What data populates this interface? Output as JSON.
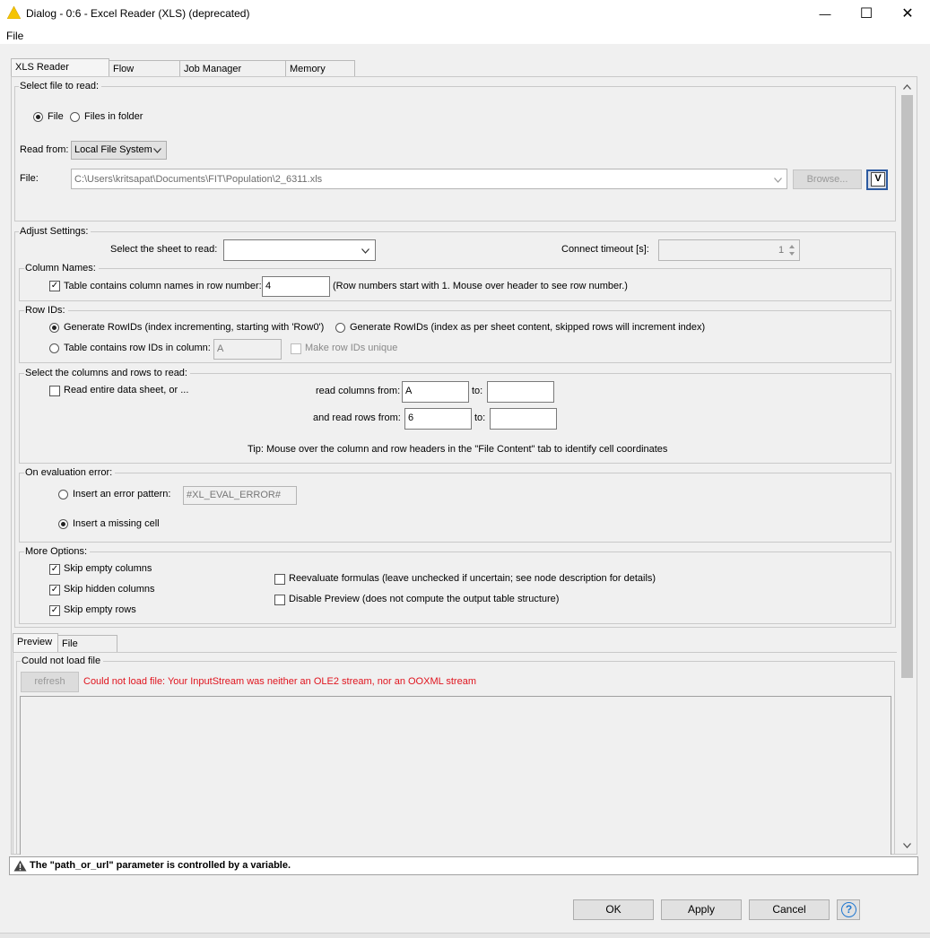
{
  "window": {
    "title": "Dialog - 0:6 - Excel Reader (XLS) (deprecated)",
    "minimize_glyph": "—",
    "maximize_glyph": "☐",
    "close_glyph": "✕"
  },
  "menu": {
    "file": "File"
  },
  "tabs": [
    "XLS Reader Settings",
    "Flow Variables",
    "Job Manager Selection",
    "Memory Policy"
  ],
  "select_file": {
    "legend": "Select file to read:",
    "radio_file": "File",
    "radio_folder": "Files in folder",
    "read_from_label": "Read from:",
    "read_from_value": "Local File System",
    "file_label": "File:",
    "file_path": "C:\\Users\\kritsapat\\Documents\\FIT\\Population\\2_6311.xls",
    "browse": "Browse...",
    "var_button": "V"
  },
  "adjust": {
    "legend": "Adjust Settings:",
    "sheet_label": "Select the sheet to read:",
    "sheet_value": "",
    "timeout_label": "Connect timeout [s]:",
    "timeout_value": "1",
    "column_names": {
      "legend": "Column Names:",
      "checkbox_label": "Table contains column names in row number:",
      "row_number": "4",
      "hint": "(Row numbers start with 1. Mouse over header to see row number.)"
    },
    "row_ids": {
      "legend": "Row IDs:",
      "gen_incrementing": "Generate RowIDs (index incrementing, starting with 'Row0')",
      "gen_sheet": "Generate RowIDs (index as per sheet content, skipped rows will increment index)",
      "in_column_label": "Table contains row IDs in column:",
      "in_column_value": "A",
      "make_unique": "Make row IDs unique"
    },
    "cols_rows": {
      "legend": "Select the columns and rows to read:",
      "entire_sheet": "Read entire data sheet, or ...",
      "read_columns_from": "read columns from:",
      "col_from": "A",
      "to1": "to:",
      "col_to": "",
      "read_rows_from": "and read rows from:",
      "row_from": "6",
      "to2": "to:",
      "row_to": "",
      "tip": "Tip: Mouse over the column and row headers in the \"File Content\" tab to identify cell coordinates"
    },
    "eval_error": {
      "legend": "On evaluation error:",
      "insert_pattern": "Insert an error pattern:",
      "pattern_value": "#XL_EVAL_ERROR#",
      "insert_missing": "Insert a missing cell"
    },
    "more_options": {
      "legend": "More Options:",
      "skip_empty_columns": "Skip empty columns",
      "skip_hidden_columns": "Skip hidden columns",
      "skip_empty_rows": "Skip empty rows",
      "reevaluate": "Reevaluate formulas (leave unchecked if uncertain; see node description for details)",
      "disable_preview": "Disable Preview  (does not compute the output table structure)"
    }
  },
  "preview": {
    "tabs": [
      "Preview",
      "File Content"
    ],
    "legend": "Could not load file",
    "refresh": "refresh",
    "error": "Could not load file: Your InputStream was neither an OLE2 stream, nor an OOXML stream"
  },
  "status": {
    "warning": "The \"path_or_url\" parameter is controlled by a variable."
  },
  "buttons": {
    "ok": "OK",
    "apply": "Apply",
    "cancel": "Cancel",
    "help": "?"
  },
  "colors": {
    "error_text": "#e0141e",
    "warning_yellow": "#f5c400",
    "help_blue": "#1f77d0"
  }
}
